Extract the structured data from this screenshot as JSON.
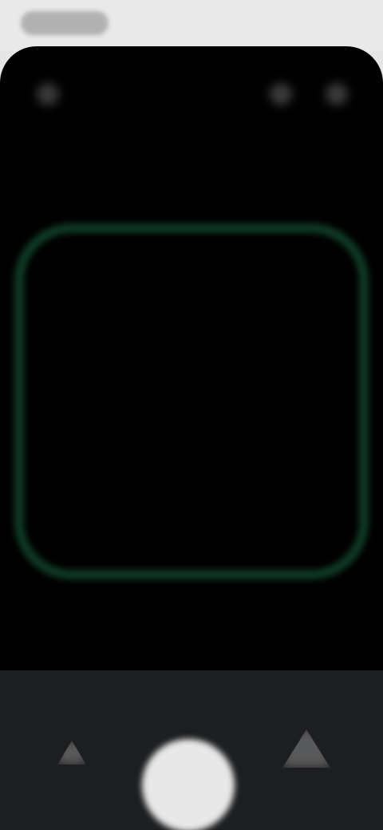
{
  "colors": {
    "status_bar": "#e9e9e9",
    "screen": "#000000",
    "frame_accent": "#0f3a24",
    "bottom_bar": "#1c1e20",
    "shutter": "#e8e8e8"
  },
  "icons": {
    "top_left": "settings-icon",
    "top_mid": "flash-icon",
    "top_right": "more-icon",
    "bottom_left": "gallery-icon",
    "bottom_right": "switch-camera-icon"
  }
}
